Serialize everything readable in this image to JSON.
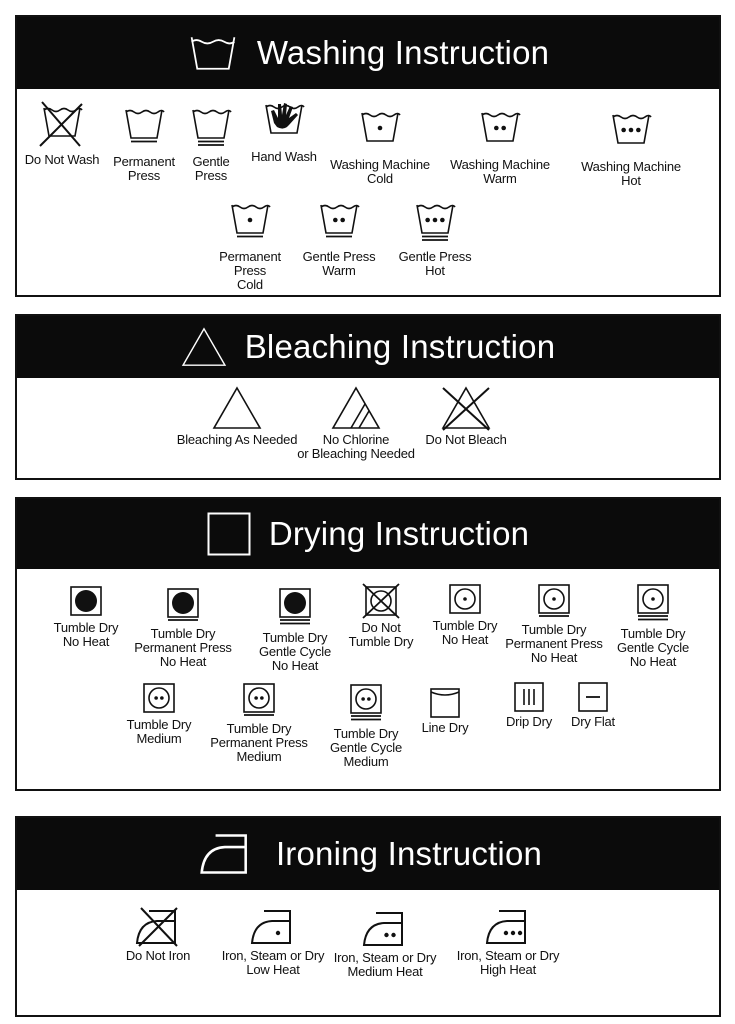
{
  "sections": [
    {
      "title": "Washing Instruction",
      "header_icon": "wash-basin-icon",
      "items": [
        {
          "icon": "basin",
          "cross": true,
          "lines": [
            "Do Not Wash"
          ]
        },
        {
          "icon": "basin",
          "bars": 1,
          "lines": [
            "Permanent",
            "Press"
          ]
        },
        {
          "icon": "basin",
          "bars": 2,
          "lines": [
            "Gentle",
            "Press"
          ]
        },
        {
          "icon": "basin",
          "hand": true,
          "lines": [
            "Hand Wash"
          ]
        },
        {
          "icon": "basin",
          "dots": 1,
          "lines": [
            "Washing Machine",
            "Cold"
          ]
        },
        {
          "icon": "basin",
          "dots": 2,
          "lines": [
            "Washing Machine",
            "Warm"
          ]
        },
        {
          "icon": "basin",
          "dots": 3,
          "lines": [
            "Washing Machine",
            "Hot"
          ]
        },
        {
          "icon": "basin",
          "dots": 1,
          "bars": 1,
          "lines": [
            "Permanent",
            "Press",
            "Cold"
          ]
        },
        {
          "icon": "basin",
          "dots": 2,
          "bars": 1,
          "lines": [
            "Gentle Press",
            "Warm"
          ]
        },
        {
          "icon": "basin",
          "dots": 3,
          "bars": 2,
          "lines": [
            "Gentle Press",
            "Hot"
          ]
        }
      ]
    },
    {
      "title": "Bleaching Instruction",
      "header_icon": "triangle-icon",
      "items": [
        {
          "icon": "triangle",
          "lines": [
            "Bleaching As Needed"
          ]
        },
        {
          "icon": "triangle",
          "stripes": true,
          "lines": [
            "No Chlorine",
            "or Bleaching Needed"
          ]
        },
        {
          "icon": "triangle",
          "cross": true,
          "lines": [
            "Do Not Bleach"
          ]
        }
      ]
    },
    {
      "title": "Drying Instruction",
      "header_icon": "square-icon",
      "items": [
        {
          "icon": "tumble",
          "filled": true,
          "lines": [
            "Tumble Dry",
            "No Heat"
          ]
        },
        {
          "icon": "tumble",
          "filled": true,
          "bars": 1,
          "lines": [
            "Tumble Dry",
            "Permanent Press",
            "No Heat"
          ]
        },
        {
          "icon": "tumble",
          "filled": true,
          "bars": 2,
          "lines": [
            "Tumble Dry",
            "Gentle Cycle",
            "No Heat"
          ]
        },
        {
          "icon": "tumble",
          "cross": true,
          "lines": [
            "Do Not",
            "Tumble Dry"
          ]
        },
        {
          "icon": "tumble",
          "dots": 1,
          "lines": [
            "Tumble Dry",
            "No Heat"
          ]
        },
        {
          "icon": "tumble",
          "dots": 1,
          "bars": 1,
          "lines": [
            "Tumble Dry",
            "Permanent Press",
            "No Heat"
          ]
        },
        {
          "icon": "tumble",
          "dots": 1,
          "bars": 2,
          "lines": [
            "Tumble Dry",
            "Gentle Cycle",
            "No Heat"
          ]
        },
        {
          "icon": "tumble",
          "dots": 2,
          "lines": [
            "Tumble Dry",
            "Medium"
          ]
        },
        {
          "icon": "tumble",
          "dots": 2,
          "bars": 1,
          "lines": [
            "Tumble Dry",
            "Permanent Press",
            "Medium"
          ]
        },
        {
          "icon": "tumble",
          "dots": 2,
          "bars": 2,
          "lines": [
            "Tumble Dry",
            "Gentle Cycle",
            "Medium"
          ]
        },
        {
          "icon": "line-dry",
          "lines": [
            "Line Dry"
          ]
        },
        {
          "icon": "drip-dry",
          "lines": [
            "Drip Dry"
          ]
        },
        {
          "icon": "dry-flat",
          "lines": [
            "Dry Flat"
          ]
        }
      ]
    },
    {
      "title": "Ironing Instruction",
      "header_icon": "iron-icon",
      "items": [
        {
          "icon": "iron",
          "cross": true,
          "lines": [
            "Do Not Iron"
          ]
        },
        {
          "icon": "iron",
          "dots": 1,
          "lines": [
            "Iron, Steam or Dry",
            "Low Heat"
          ]
        },
        {
          "icon": "iron",
          "dots": 2,
          "lines": [
            "Iron, Steam or Dry",
            "Medium Heat"
          ]
        },
        {
          "icon": "iron",
          "dots": 3,
          "lines": [
            "Iron, Steam or Dry",
            "High Heat"
          ]
        }
      ]
    }
  ]
}
